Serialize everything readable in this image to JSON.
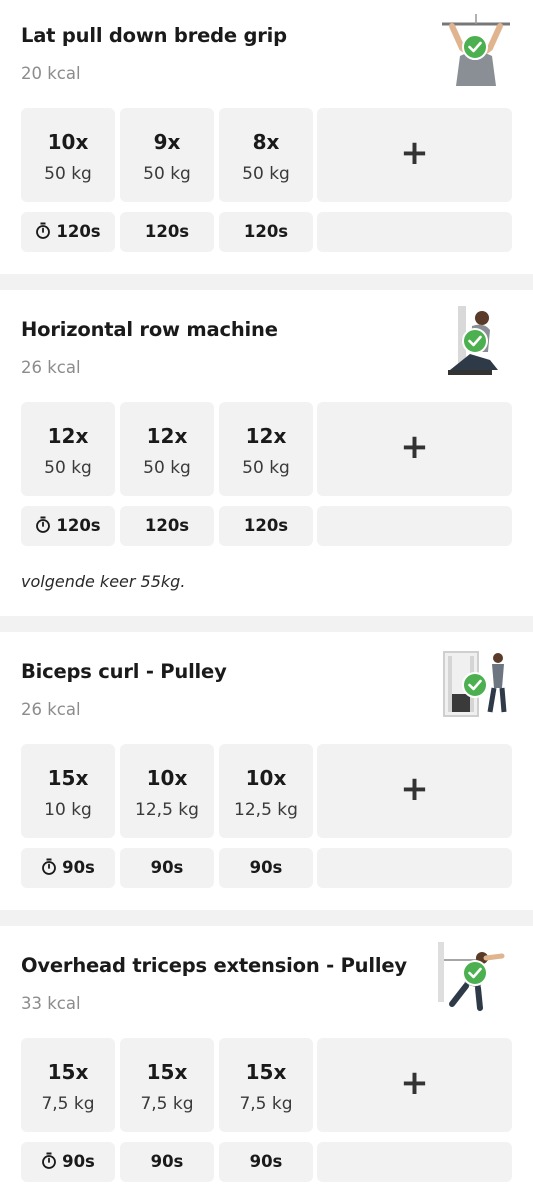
{
  "exercises": [
    {
      "title": "Lat pull down brede grip",
      "kcal": "20 kcal",
      "thumb_icon": "lat-pulldown-figure",
      "sets": [
        {
          "reps": "10x",
          "weight": "50 kg",
          "rest": "120s"
        },
        {
          "reps": "9x",
          "weight": "50 kg",
          "rest": "120s"
        },
        {
          "reps": "8x",
          "weight": "50 kg",
          "rest": "120s"
        }
      ],
      "add_label": "+",
      "note": ""
    },
    {
      "title": "Horizontal row machine",
      "kcal": "26 kcal",
      "thumb_icon": "row-machine-figure",
      "sets": [
        {
          "reps": "12x",
          "weight": "50 kg",
          "rest": "120s"
        },
        {
          "reps": "12x",
          "weight": "50 kg",
          "rest": "120s"
        },
        {
          "reps": "12x",
          "weight": "50 kg",
          "rest": "120s"
        }
      ],
      "add_label": "+",
      "note": "volgende keer 55kg."
    },
    {
      "title": "Biceps curl - Pulley",
      "kcal": "26 kcal",
      "thumb_icon": "cable-curl-figure",
      "sets": [
        {
          "reps": "15x",
          "weight": "10 kg",
          "rest": "90s"
        },
        {
          "reps": "10x",
          "weight": "12,5 kg",
          "rest": "90s"
        },
        {
          "reps": "10x",
          "weight": "12,5 kg",
          "rest": "90s"
        }
      ],
      "add_label": "+",
      "note": ""
    },
    {
      "title": "Overhead triceps extension - Pulley",
      "kcal": "33 kcal",
      "thumb_icon": "triceps-extension-figure",
      "sets": [
        {
          "reps": "15x",
          "weight": "7,5 kg",
          "rest": "90s"
        },
        {
          "reps": "15x",
          "weight": "7,5 kg",
          "rest": "90s"
        },
        {
          "reps": "15x",
          "weight": "7,5 kg",
          "rest": "90s"
        }
      ],
      "add_label": "+",
      "note": ""
    }
  ],
  "colors": {
    "background": "#f2f2f2",
    "card": "#ffffff",
    "tile": "#f2f2f2",
    "check_green": "#4cb050",
    "muted_text": "#8c8c8c"
  }
}
